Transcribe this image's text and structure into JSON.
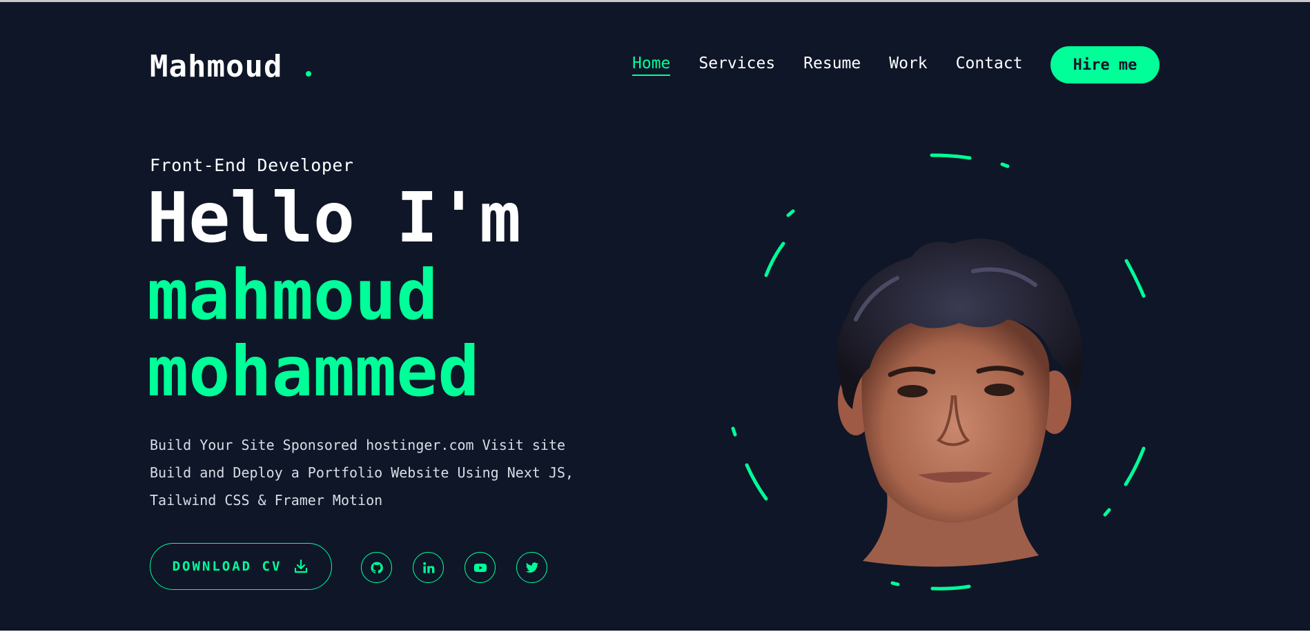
{
  "header": {
    "logo_text": "Mahmoud",
    "nav": [
      {
        "label": "Home",
        "active": true
      },
      {
        "label": "Services",
        "active": false
      },
      {
        "label": "Resume",
        "active": false
      },
      {
        "label": "Work",
        "active": false
      },
      {
        "label": "Contact",
        "active": false
      }
    ],
    "hire_label": "Hire me"
  },
  "hero": {
    "role": "Front-End Developer",
    "greeting": "Hello I'm",
    "name_line_1": "mahmoud",
    "name_line_2": "mohammed",
    "description_lines": [
      "Build Your Site Sponsored hostinger.com Visit site",
      "Build and Deploy a Portfolio Website Using Next JS,",
      "Tailwind CSS & Framer Motion"
    ],
    "download_label": "DOWNLOAD CV",
    "socials": [
      {
        "icon": "github-icon"
      },
      {
        "icon": "linkedin-icon"
      },
      {
        "icon": "youtube-icon"
      },
      {
        "icon": "twitter-icon"
      }
    ]
  },
  "colors": {
    "background": "#0f1628",
    "accent": "#00ff99",
    "text": "#ffffff"
  }
}
